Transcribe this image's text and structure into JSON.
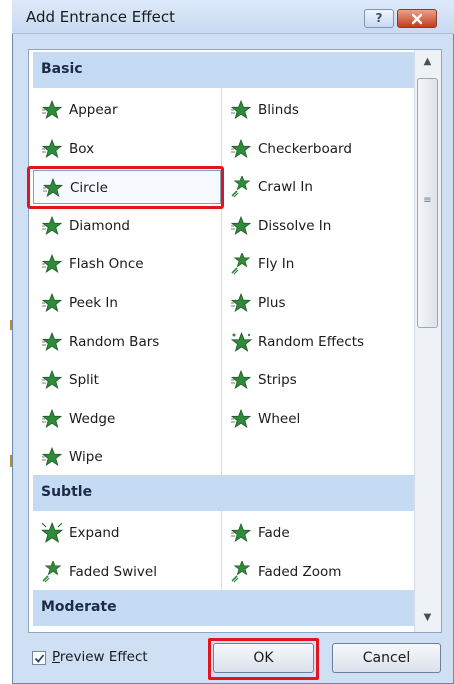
{
  "dialog": {
    "title": "Add Entrance Effect",
    "help_label": "?",
    "close_label": "X"
  },
  "sections": {
    "basic": "Basic",
    "subtle": "Subtle",
    "moderate": "Moderate"
  },
  "basic_items": [
    {
      "label": "Appear",
      "icon": "star-effect-icon"
    },
    {
      "label": "Blinds",
      "icon": "star-effect-icon"
    },
    {
      "label": "Box",
      "icon": "star-effect-icon"
    },
    {
      "label": "Checkerboard",
      "icon": "star-effect-icon"
    },
    {
      "label": "Circle",
      "icon": "star-effect-icon",
      "selected": true
    },
    {
      "label": "Crawl In",
      "icon": "star-motion-icon"
    },
    {
      "label": "Diamond",
      "icon": "star-effect-icon"
    },
    {
      "label": "Dissolve In",
      "icon": "star-effect-icon"
    },
    {
      "label": "Flash Once",
      "icon": "star-effect-icon"
    },
    {
      "label": "Fly In",
      "icon": "star-motion-icon"
    },
    {
      "label": "Peek In",
      "icon": "star-effect-icon"
    },
    {
      "label": "Plus",
      "icon": "star-effect-icon"
    },
    {
      "label": "Random Bars",
      "icon": "star-effect-icon"
    },
    {
      "label": "Random Effects",
      "icon": "star-random-icon"
    },
    {
      "label": "Split",
      "icon": "star-effect-icon"
    },
    {
      "label": "Strips",
      "icon": "star-effect-icon"
    },
    {
      "label": "Wedge",
      "icon": "star-effect-icon"
    },
    {
      "label": "Wheel",
      "icon": "star-effect-icon"
    },
    {
      "label": "Wipe",
      "icon": "star-effect-icon"
    }
  ],
  "subtle_items": [
    {
      "label": "Expand",
      "icon": "star-expand-icon"
    },
    {
      "label": "Fade",
      "icon": "star-effect-icon"
    },
    {
      "label": "Faded Swivel",
      "icon": "star-motion-icon"
    },
    {
      "label": "Faded Zoom",
      "icon": "star-motion-icon"
    }
  ],
  "footer": {
    "preview_label_underlined": "P",
    "preview_label_rest": "review Effect",
    "preview_checked": true,
    "ok_label": "OK",
    "cancel_label": "Cancel"
  },
  "colors": {
    "star_green": "#2f8a3a",
    "highlight_red": "#e3141a",
    "section_blue": "#c5dbf3"
  }
}
